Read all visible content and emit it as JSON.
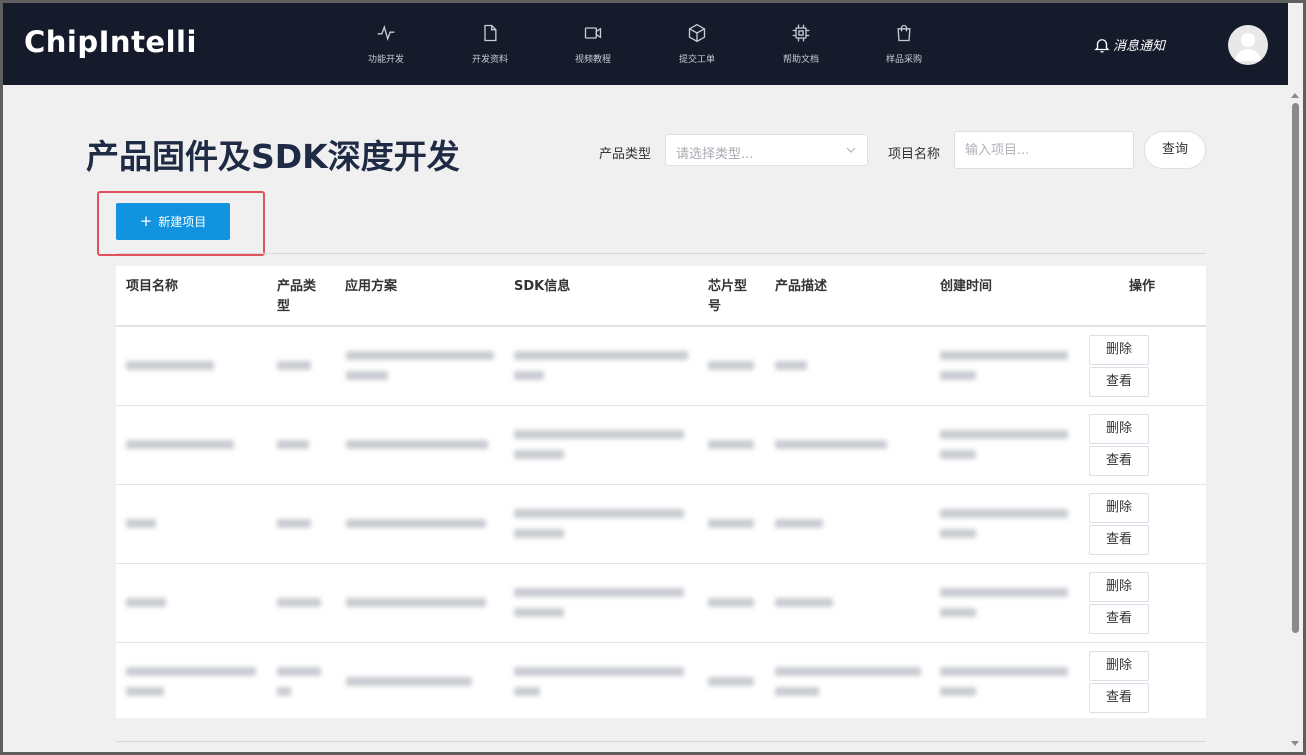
{
  "brand": {
    "logo": "ChipIntelli"
  },
  "nav": [
    {
      "label": "功能开发",
      "icon": "activity-icon"
    },
    {
      "label": "开发资料",
      "icon": "file-icon"
    },
    {
      "label": "视频教程",
      "icon": "video-icon"
    },
    {
      "label": "提交工单",
      "icon": "cube-icon"
    },
    {
      "label": "帮助文档",
      "icon": "chip-icon"
    },
    {
      "label": "样品采购",
      "icon": "shopping-bag-icon"
    }
  ],
  "header": {
    "notify_label": "消息通知"
  },
  "page": {
    "title": "产品固件及SDK深度开发"
  },
  "filters": {
    "type_label": "产品类型",
    "type_placeholder": "请选择类型...",
    "name_label": "项目名称",
    "name_placeholder": "输入项目...",
    "query_label": "查询"
  },
  "actions": {
    "new_project": "新建项目"
  },
  "table": {
    "headers": {
      "name": "项目名称",
      "type": "产品类型",
      "solution": "应用方案",
      "sdk": "SDK信息",
      "chip": "芯片型号",
      "desc": "产品描述",
      "created": "创建时间",
      "ops": "操作"
    },
    "row_actions": {
      "delete": "删除",
      "view": "查看"
    },
    "rows_count_visible": 5
  },
  "colors": {
    "topbar": "#161b2c",
    "primary_button": "#1193e0",
    "highlight_border": "#e0515c",
    "title": "#1f2a44"
  }
}
